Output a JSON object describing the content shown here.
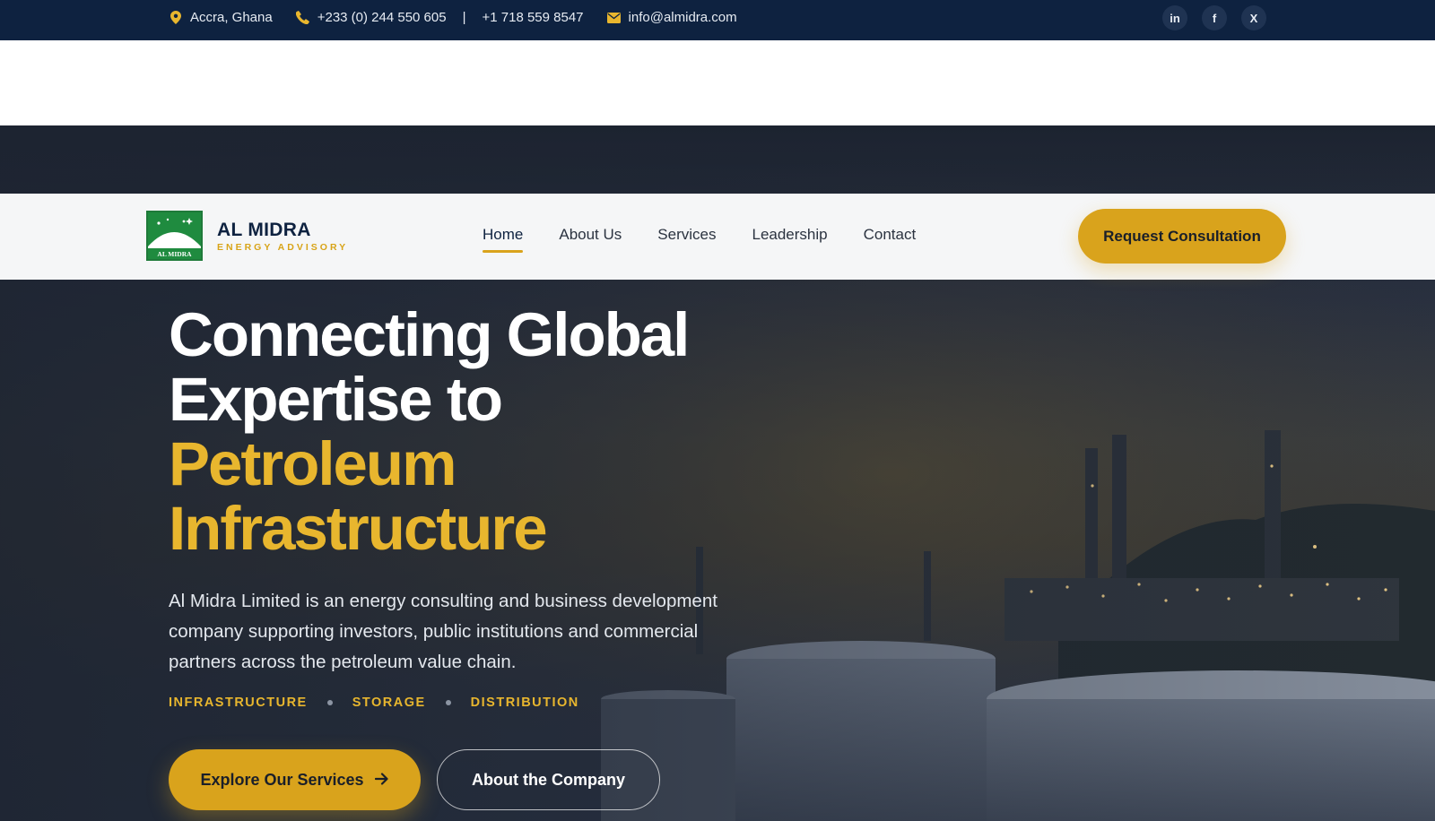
{
  "topbar": {
    "location": "Accra, Ghana",
    "phone_primary": "+233 (0) 244 550 605",
    "phone_separator": "|",
    "phone_secondary": "+1 718 559 8547",
    "email": "info@almidra.com",
    "socials": [
      {
        "icon": "linkedin-icon",
        "label": "in"
      },
      {
        "icon": "facebook-icon",
        "label": "f"
      },
      {
        "icon": "x-icon",
        "label": "X"
      }
    ]
  },
  "brand": {
    "name": "AL MIDRA",
    "tagline": "ENERGY ADVISORY",
    "logo_caption": "AL MIDRA"
  },
  "nav": {
    "items": [
      {
        "label": "Home",
        "active": true
      },
      {
        "label": "About Us",
        "active": false
      },
      {
        "label": "Services",
        "active": false
      },
      {
        "label": "Leadership",
        "active": false
      },
      {
        "label": "Contact",
        "active": false
      }
    ],
    "cta": "Request Consultation"
  },
  "hero": {
    "headline_line1": "Connecting Global",
    "headline_line2": "Expertise to",
    "headline_gold1": "Petroleum",
    "headline_gold2": "Infrastructure",
    "description": "Al Midra Limited is an energy consulting and business development company supporting investors, public institutions and commercial partners across the petroleum value chain.",
    "tags": [
      "INFRASTRUCTURE",
      "STORAGE",
      "DISTRIBUTION"
    ],
    "primary_button": "Explore Our Services",
    "secondary_button": "About the Company"
  },
  "colors": {
    "navy": "#0e2240",
    "gold": "#d9a31c",
    "gold_text": "#e8b62e"
  }
}
